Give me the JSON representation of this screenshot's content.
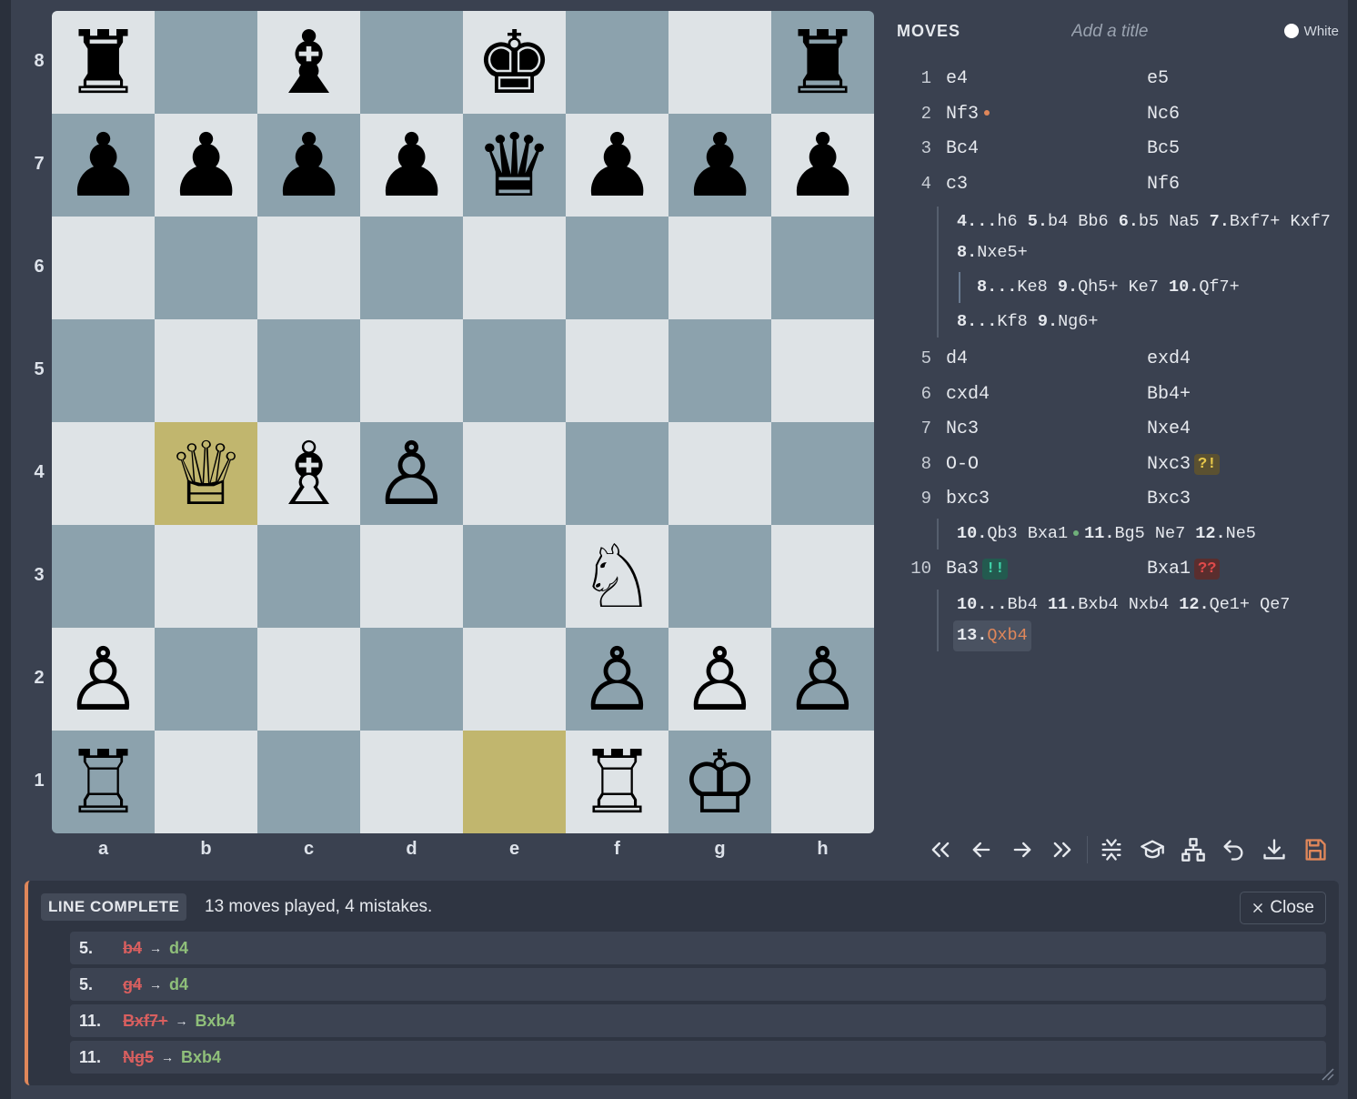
{
  "board": {
    "ranks": [
      "8",
      "7",
      "6",
      "5",
      "4",
      "3",
      "2",
      "1"
    ],
    "files": [
      "a",
      "b",
      "c",
      "d",
      "e",
      "f",
      "g",
      "h"
    ],
    "rows": [
      [
        "♜",
        "",
        "♝",
        "",
        "♚",
        "",
        "",
        "♜"
      ],
      [
        "♟",
        "♟",
        "♟",
        "♟",
        "♛",
        "♟",
        "♟",
        "♟"
      ],
      [
        "",
        "",
        "",
        "",
        "",
        "",
        "",
        ""
      ],
      [
        "",
        "",
        "",
        "",
        "",
        "",
        "",
        ""
      ],
      [
        "",
        "♕",
        "♗",
        "♙",
        "",
        "",
        "",
        ""
      ],
      [
        "",
        "",
        "",
        "",
        "",
        "♘",
        "",
        ""
      ],
      [
        "♙",
        "",
        "",
        "",
        "",
        "♙",
        "♙",
        "♙"
      ],
      [
        "♖",
        "",
        "",
        "",
        "",
        "♖",
        "♔",
        ""
      ]
    ],
    "highlight_squares": [
      "b4",
      "e1"
    ],
    "colors": {
      "light": "#dee3e6",
      "dark": "#8ca2ad",
      "highlight": "#c1b66e"
    }
  },
  "panel": {
    "title": "MOVES",
    "title_placeholder": "Add a title",
    "side_label": "White"
  },
  "moves": {
    "m1": {
      "num": "1",
      "white": "e4",
      "black": "e5"
    },
    "m2": {
      "num": "2",
      "white": "Nf3",
      "black": "Nc6"
    },
    "m3": {
      "num": "3",
      "white": "Bc4",
      "black": "Bc5"
    },
    "m4": {
      "num": "4",
      "white": "c3",
      "black": "Nf6"
    },
    "var4": {
      "a1": "4...",
      "a2": "h6",
      "a3": "5.",
      "a4": "b4 Bb6",
      "a5": "6.",
      "a6": "b5 Na5",
      "a7": "7.",
      "a8": "Bxf7+",
      "b1": "Kxf7",
      "b2": "8.",
      "b3": "Nxe5+",
      "c1": "8...",
      "c2": "Ke8",
      "c3": "9.",
      "c4": "Qh5+ Ke7",
      "c5": "10.",
      "c6": "Qf7+",
      "d1": "8...",
      "d2": "Kf8",
      "d3": "9.",
      "d4": "Ng6+"
    },
    "m5": {
      "num": "5",
      "white": "d4",
      "black": "exd4"
    },
    "m6": {
      "num": "6",
      "white": "cxd4",
      "black": "Bb4+"
    },
    "m7": {
      "num": "7",
      "white": "Nc3",
      "black": "Nxe4"
    },
    "m8": {
      "num": "8",
      "white": "O-O",
      "black": "Nxc3",
      "black_nag": "?!"
    },
    "m9": {
      "num": "9",
      "white": "bxc3",
      "black": "Bxc3"
    },
    "var9": {
      "a1": "10.",
      "a2": "Qb3 Bxa1",
      "a3": "11.",
      "a4": "Bg5 Ne7",
      "a5": "12.",
      "a6": "Ne5"
    },
    "m10": {
      "num": "10",
      "white": "Ba3",
      "white_nag": "!!",
      "black": "Bxa1",
      "black_nag": "??"
    },
    "var10": {
      "a1": "10...",
      "a2": "Bb4",
      "a3": "11.",
      "a4": "Bxb4 Nxb4",
      "a5": "12.",
      "a6": "Qe1+ Qe7",
      "b1": "13.",
      "b2": "Qxb4"
    }
  },
  "toolbar": {
    "buttons": [
      "first-icon",
      "prev-icon",
      "next-icon",
      "last-icon",
      "collapse-icon",
      "learn-icon",
      "tree-icon",
      "undo-icon",
      "download-icon",
      "save-icon"
    ],
    "accent": "#e0875a"
  },
  "result": {
    "badge": "LINE COMPLETE",
    "summary": "13 moves played, 4 mistakes.",
    "close_label": "Close",
    "mistakes": [
      {
        "num": "5.",
        "wrong": "b4",
        "arrow": "→",
        "right": "d4"
      },
      {
        "num": "5.",
        "wrong": "g4",
        "arrow": "→",
        "right": "d4"
      },
      {
        "num": "11.",
        "wrong": "Bxf7+",
        "arrow": "→",
        "right": "Bxb4"
      },
      {
        "num": "11.",
        "wrong": "Ng5",
        "arrow": "→",
        "right": "Bxb4"
      }
    ]
  }
}
